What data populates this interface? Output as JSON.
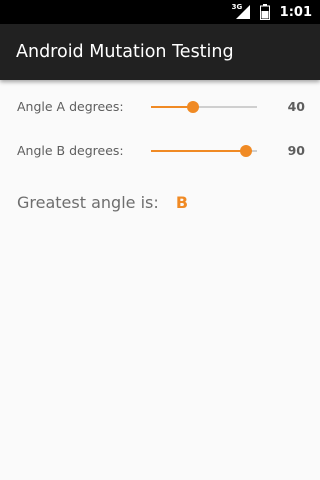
{
  "status_bar": {
    "network_type": "3G",
    "time": "1:01",
    "icons": [
      "signal-icon",
      "battery-icon"
    ]
  },
  "app_bar": {
    "title": "Android Mutation Testing"
  },
  "theme": {
    "accent": "#f08a24",
    "app_bar_bg": "#212121",
    "background": "#fafafa"
  },
  "angle_a": {
    "label": "Angle A degrees:",
    "value": "40",
    "slider_fraction": 0.4
  },
  "angle_b": {
    "label": "Angle B degrees:",
    "value": "90",
    "slider_fraction": 0.9
  },
  "result": {
    "label": "Greatest angle is:",
    "value": "B"
  }
}
